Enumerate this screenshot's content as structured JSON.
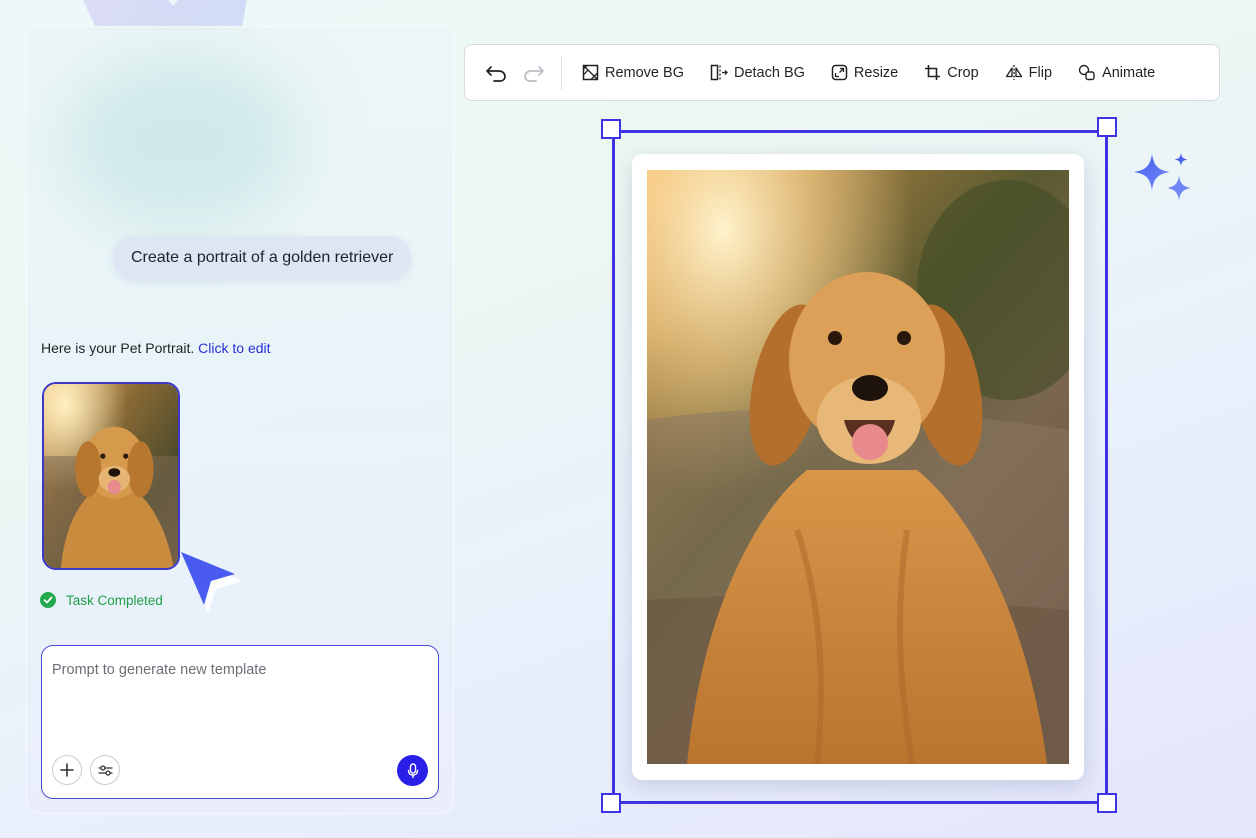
{
  "toolbar": {
    "undo_icon": "undo-icon",
    "redo_icon": "redo-icon",
    "buttons": [
      {
        "label": "Remove BG",
        "icon": "remove-bg-icon"
      },
      {
        "label": "Detach BG",
        "icon": "detach-bg-icon"
      },
      {
        "label": "Resize",
        "icon": "resize-icon"
      },
      {
        "label": "Crop",
        "icon": "crop-icon"
      },
      {
        "label": "Flip",
        "icon": "flip-icon"
      },
      {
        "label": "Animate",
        "icon": "animate-icon"
      }
    ]
  },
  "chat": {
    "user_message": "Create a portrait of a golden retriever",
    "reply_text": "Here is your Pet Portrait.",
    "reply_link": "Click to edit",
    "status": "Task Completed",
    "status_color": "#22a84d"
  },
  "prompt": {
    "placeholder": "Prompt to generate new template",
    "value": ""
  },
  "colors": {
    "accent": "#3d33e4",
    "link": "#2a2fd6",
    "mic_button": "#2a1fe6"
  }
}
